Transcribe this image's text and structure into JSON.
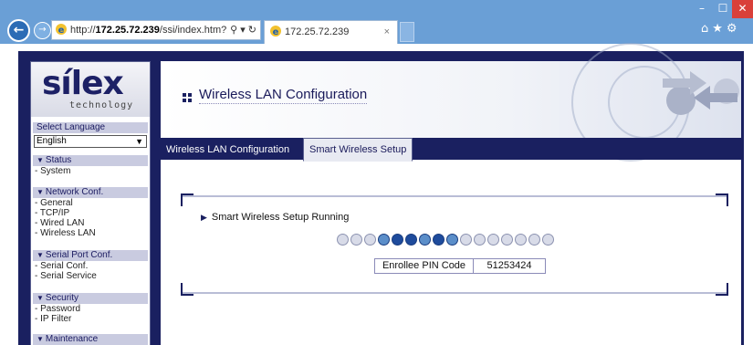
{
  "browser": {
    "url_prefix": "http://",
    "url_host": "172.25.72.239",
    "url_path": "/ssi/index.htm?pa",
    "tab_title": "172.25.72.239",
    "win_min": "–",
    "win_max": "☐",
    "win_close": "✕",
    "tab_close": "×",
    "toolbar_icons": "⌂★⚙"
  },
  "sidebar": {
    "logo_text": "sílex",
    "logo_sub": "technology",
    "select_language_label": "Select Language",
    "language_value": "English",
    "sections": [
      {
        "title": "Status",
        "links": [
          "- System"
        ]
      },
      {
        "title": "Network Conf.",
        "links": [
          "- General",
          "- TCP/IP",
          "- Wired LAN",
          "- Wireless LAN"
        ]
      },
      {
        "title": "Serial Port Conf.",
        "links": [
          "- Serial Conf.",
          "- Serial Service"
        ]
      },
      {
        "title": "Security",
        "links": [
          "- Password",
          "- IP Filter"
        ]
      },
      {
        "title": "Maintenance",
        "links": []
      }
    ]
  },
  "main": {
    "page_title": "Wireless LAN Configuration",
    "tabs": [
      {
        "label": "Wireless LAN Configuration",
        "active": false
      },
      {
        "label": "Smart Wireless Setup",
        "active": true
      }
    ],
    "status_text": "Smart Wireless Setup Running",
    "progress": {
      "total": 16,
      "states": [
        0,
        0,
        0,
        1,
        2,
        2,
        1,
        2,
        1,
        0,
        0,
        0,
        0,
        0,
        0,
        0
      ]
    },
    "pin_label": "Enrollee PIN Code",
    "pin_value": "51253424"
  },
  "colors": {
    "brand_navy": "#1a2060",
    "dot_empty": "#d8dbe8",
    "dot_mid": "#5b8ec9",
    "dot_full": "#1e4b9c"
  }
}
